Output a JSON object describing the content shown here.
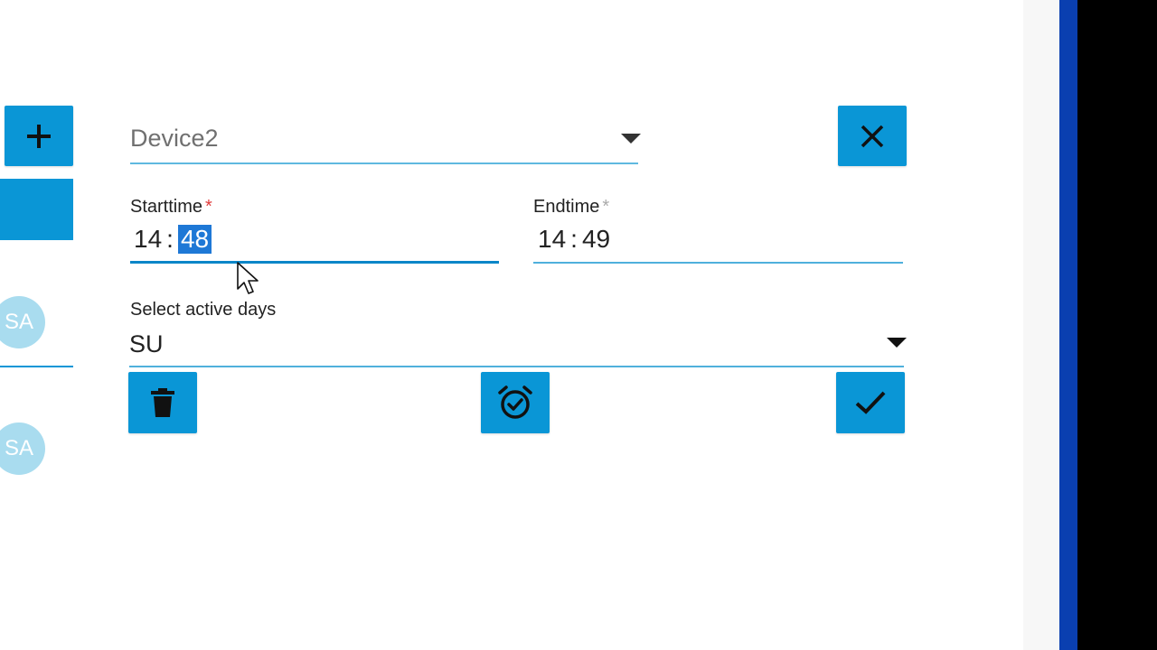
{
  "device_select": {
    "value": "Device2"
  },
  "starttime": {
    "label": "Starttime",
    "required_mark": "*",
    "hours": "14",
    "separator": ":",
    "minutes": "48"
  },
  "endtime": {
    "label": "Endtime",
    "required_mark": "*",
    "hours": "14",
    "separator": ":",
    "minutes": "49"
  },
  "active_days": {
    "label": "Select active days",
    "value": "SU"
  },
  "sidebar": {
    "avatars": [
      "SA",
      "SA"
    ]
  },
  "colors": {
    "accent": "#0a96d6",
    "selection": "#1e78d6",
    "required": "#e03b3b"
  }
}
